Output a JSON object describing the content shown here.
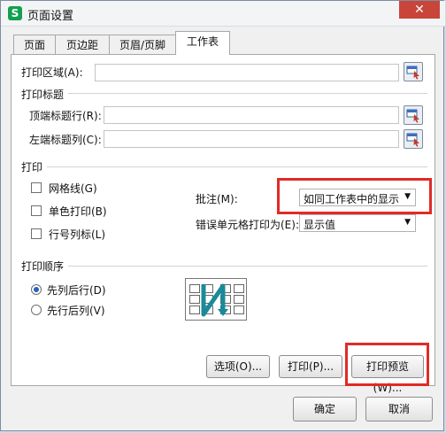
{
  "window": {
    "title": "页面设置",
    "app_icon": "S"
  },
  "tabs": [
    {
      "label": "页面"
    },
    {
      "label": "页边距"
    },
    {
      "label": "页眉/页脚"
    },
    {
      "label": "工作表",
      "active": true
    }
  ],
  "print_area": {
    "label": "打印区域(A):",
    "value": ""
  },
  "print_titles": {
    "section_label": "打印标题",
    "top_row_label": "顶端标题行(R):",
    "top_row_value": "",
    "left_col_label": "左端标题列(C):",
    "left_col_value": ""
  },
  "print_section": {
    "section_label": "打印",
    "gridlines": {
      "label": "网格线(G)",
      "checked": false
    },
    "monochrome": {
      "label": "单色打印(B)",
      "checked": false
    },
    "row_col_headings": {
      "label": "行号列标(L)",
      "checked": false
    },
    "comments_label": "批注(M):",
    "comments_value": "如同工作表中的显示",
    "errors_label": "错误单元格打印为(E):",
    "errors_value": "显示值"
  },
  "page_order": {
    "section_label": "打印顺序",
    "down_then_over": {
      "label": "先列后行(D)",
      "checked": true
    },
    "over_then_down": {
      "label": "先行后列(V)",
      "checked": false
    }
  },
  "panel_buttons": {
    "options": "选项(O)...",
    "print": "打印(P)...",
    "print_preview": "打印预览(W)..."
  },
  "footer": {
    "ok": "确定",
    "cancel": "取消"
  },
  "colors": {
    "highlight": "#e02b26",
    "accent": "#2a62b7",
    "preview_arrow": "#1a8a9a"
  }
}
